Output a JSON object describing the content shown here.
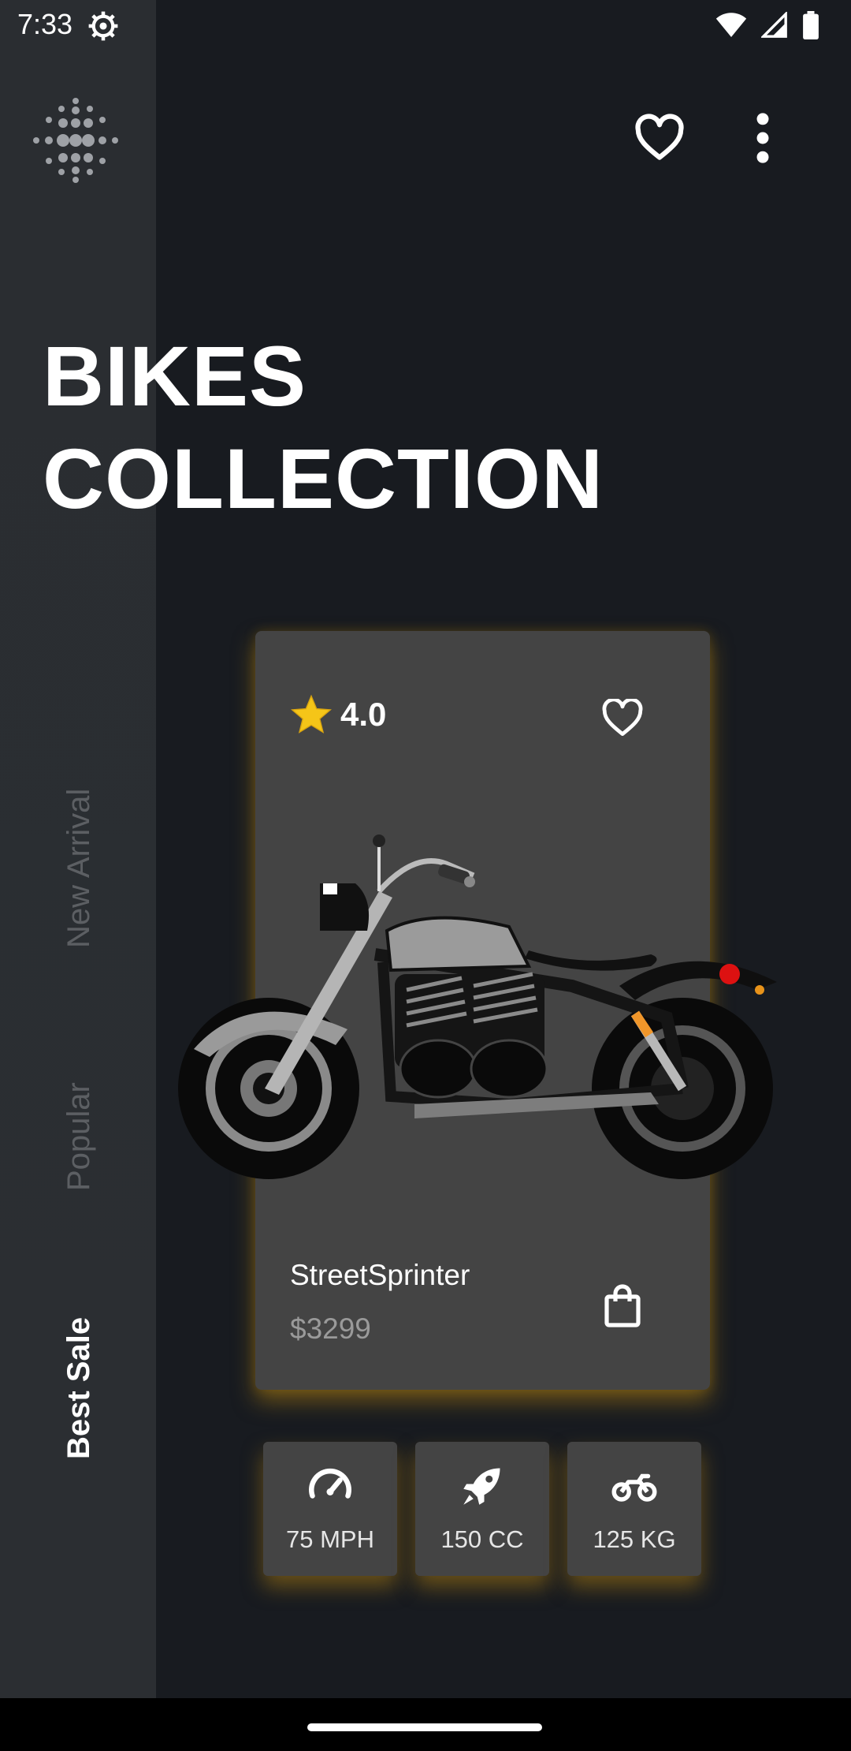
{
  "status": {
    "time": "7:33"
  },
  "header": {
    "title_line1": "BIKES",
    "title_line2": "COLLECTION"
  },
  "categories": [
    {
      "label": "New Arrival",
      "active": false
    },
    {
      "label": "Popular",
      "active": false
    },
    {
      "label": "Best Sale",
      "active": true
    }
  ],
  "product": {
    "rating": "4.0",
    "name": "StreetSprinter",
    "price": "$3299"
  },
  "specs": [
    {
      "label": "75 MPH",
      "icon": "speedometer-icon"
    },
    {
      "label": "150 CC",
      "icon": "rocket-icon"
    },
    {
      "label": "125 KG",
      "icon": "motorcycle-icon"
    }
  ],
  "colors": {
    "background": "#181b20",
    "sidebar": "#2a2d31",
    "card": "#444444",
    "accent_glow": "#b58412",
    "star": "#f5c518"
  }
}
